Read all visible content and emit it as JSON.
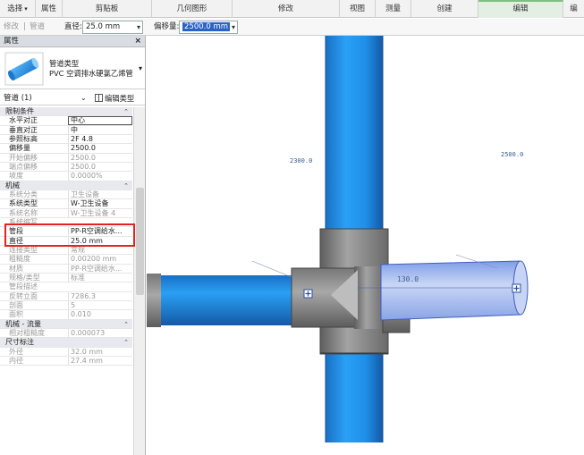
{
  "ribbon": {
    "tabs": [
      {
        "label": "选择",
        "dropdown": true
      },
      {
        "label": "属性"
      },
      {
        "label": "剪贴板"
      },
      {
        "label": "几何图形"
      },
      {
        "label": "修改"
      },
      {
        "label": "视图"
      },
      {
        "label": "测量"
      },
      {
        "label": "创建"
      },
      {
        "label": "编辑"
      },
      {
        "label": "编"
      }
    ]
  },
  "options_bar": {
    "modify_label": "修改",
    "separator": "|",
    "pipe_label": "管道",
    "diameter_label": "直径:",
    "diameter_value": "25.0 mm",
    "offset_label": "偏移量:",
    "offset_value": "2500.0 mm"
  },
  "properties": {
    "title": "属性",
    "close": "×",
    "type_line1": "管道类型",
    "type_line2": "PVC 空调排水硬氯乙烯管",
    "selector_label": "管道 (1)",
    "edit_type_label": "编辑类型",
    "rows": [
      {
        "kind": "section",
        "label": "限制条件"
      },
      {
        "label": "水平对正",
        "value": "中心",
        "editing": true
      },
      {
        "label": "垂直对正",
        "value": "中"
      },
      {
        "label": "参照标高",
        "value": "2F  4.8"
      },
      {
        "label": "偏移量",
        "value": "2500.0"
      },
      {
        "label": "开始偏移",
        "value": "2500.0",
        "disabled": true
      },
      {
        "label": "端点偏移",
        "value": "2500.0",
        "disabled": true
      },
      {
        "label": "坡度",
        "value": "0.0000%",
        "disabled": true
      },
      {
        "kind": "section",
        "label": "机械"
      },
      {
        "label": "系统分类",
        "value": "卫生设备",
        "disabled": true
      },
      {
        "label": "系统类型",
        "value": "W-卫生设备"
      },
      {
        "label": "系统名称",
        "value": "W-卫生设备 4",
        "disabled": true
      },
      {
        "label": "系统缩写",
        "value": "",
        "disabled": true
      },
      {
        "label": "管段",
        "value": "PP-R空调给水..."
      },
      {
        "label": "直径",
        "value": "25.0 mm"
      },
      {
        "label": "连接类型",
        "value": "常规",
        "disabled": true
      },
      {
        "label": "粗糙度",
        "value": "0.00200 mm",
        "disabled": true
      },
      {
        "label": "材质",
        "value": "PP-R空调给水...",
        "disabled": true
      },
      {
        "label": "规格/类型",
        "value": "标准",
        "disabled": true
      },
      {
        "label": "管段描述",
        "value": "",
        "disabled": true
      },
      {
        "label": "反转立面",
        "value": "7286.3",
        "disabled": true
      },
      {
        "label": "剖面",
        "value": "5",
        "disabled": true
      },
      {
        "label": "面积",
        "value": "0.010",
        "disabled": true
      },
      {
        "kind": "section",
        "label": "机械 - 流量"
      },
      {
        "label": "相对粗糙度",
        "value": "0.000073",
        "disabled": true
      },
      {
        "kind": "section",
        "label": "尺寸标注"
      },
      {
        "label": "外径",
        "value": "32.0 mm",
        "disabled": true
      },
      {
        "label": "内径",
        "value": "27.4 mm",
        "disabled": true
      }
    ]
  },
  "viewport": {
    "dim_left": "2300.0",
    "dim_right": "2500.0",
    "dim_branch": "130.0",
    "colors": {
      "pipe_blue": "#1f8fe8",
      "pipe_selected": "#b8c8f0",
      "fitting_gray": "#8a8a8a",
      "highlight_red": "#e52222"
    }
  }
}
